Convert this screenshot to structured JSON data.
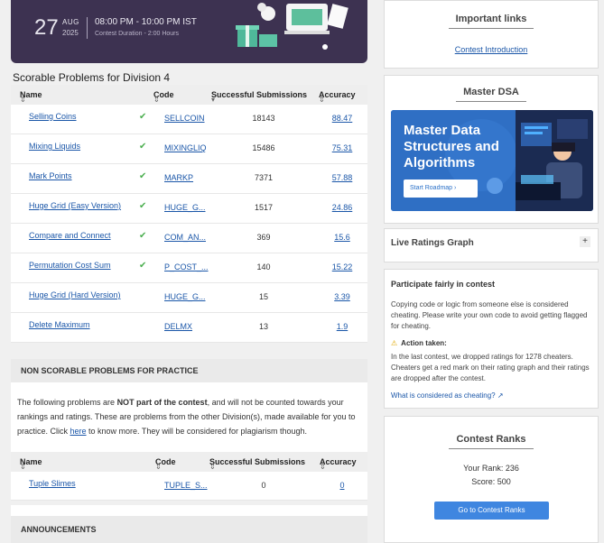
{
  "banner": {
    "day": "27",
    "month": "AUG",
    "year": "2025",
    "time": "08:00 PM - 10:00 PM IST",
    "duration": "Contest Duration - 2:00 Hours"
  },
  "scorable": {
    "title": "Scorable Problems for Division 4",
    "headers": {
      "name": "Name",
      "code": "Code",
      "submissions": "Successful Submissions",
      "accuracy": "Accuracy"
    },
    "rows": [
      {
        "name": "Selling Coins",
        "solved": true,
        "code": "SELLCOIN",
        "submissions": "18143",
        "accuracy": "88.47"
      },
      {
        "name": "Mixing Liquids",
        "solved": true,
        "code": "MIXINGLIQ",
        "submissions": "15486",
        "accuracy": "75.31"
      },
      {
        "name": "Mark Points",
        "solved": true,
        "code": "MARKP",
        "submissions": "7371",
        "accuracy": "57.88"
      },
      {
        "name": "Huge Grid (Easy Version)",
        "solved": true,
        "code": "HUGE_G...",
        "submissions": "1517",
        "accuracy": "24.86"
      },
      {
        "name": "Compare and Connect",
        "solved": true,
        "code": "COM_AN...",
        "submissions": "369",
        "accuracy": "15.6"
      },
      {
        "name": "Permutation Cost Sum",
        "solved": true,
        "code": "P_COST_...",
        "submissions": "140",
        "accuracy": "15.22"
      },
      {
        "name": "Huge Grid (Hard Version)",
        "solved": false,
        "code": "HUGE_G...",
        "submissions": "15",
        "accuracy": "3.39"
      },
      {
        "name": "Delete Maximum",
        "solved": false,
        "code": "DELMX",
        "submissions": "13",
        "accuracy": "1.9"
      }
    ]
  },
  "non_scorable": {
    "title": "NON SCORABLE PROBLEMS FOR PRACTICE",
    "text_a": "The following problems are ",
    "text_bold": "NOT part of the contest",
    "text_b": ", and will not be counted towards your rankings and ratings. These are problems from the other Division(s), made available for you to practice. Click ",
    "link": "here",
    "text_c": " to know more. They will be considered for plagiarism though.",
    "headers": {
      "name": "Name",
      "code": "Code",
      "submissions": "Successful Submissions",
      "accuracy": "Accuracy"
    },
    "rows": [
      {
        "name": "Tuple Slimes",
        "code": "TUPLE_S...",
        "submissions": "0",
        "accuracy": "0"
      }
    ]
  },
  "announcements": {
    "title": "ANNOUNCEMENTS"
  },
  "important_links": {
    "title": "Important links",
    "link": "Contest Introduction"
  },
  "master_dsa": {
    "title": "Master DSA",
    "headline": "Master Data Structures and Algorithms",
    "button": "Start Roadmap ›"
  },
  "ratings_graph": {
    "title": "Live Ratings Graph",
    "toggle": "+"
  },
  "fair": {
    "title": "Participate fairly in contest",
    "para": "Copying code or logic from someone else is considered cheating. Please write your own code to avoid getting flagged for cheating.",
    "action_title": "Action taken:",
    "action_text": "In the last contest, we dropped ratings for 1278 cheaters. Cheaters get a red mark on their rating graph and their ratings are dropped after the contest.",
    "link": "What is considered as cheating?"
  },
  "ranks": {
    "title": "Contest Ranks",
    "rank": "Your Rank: 236",
    "score": "Score: 500",
    "button": "Go to Contest Ranks"
  },
  "colors": {
    "banner": "#3d3251",
    "link": "#1a56a8",
    "check": "#4caf50",
    "button": "#3f86e0"
  }
}
